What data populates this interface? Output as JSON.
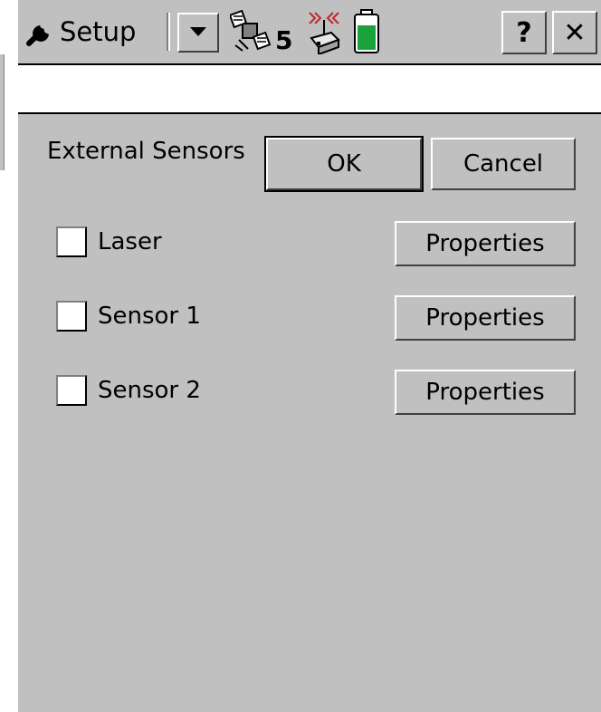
{
  "titlebar": {
    "app_name": "Setup",
    "satellite_count": "5",
    "help_label": "?",
    "close_label": "✕"
  },
  "input_bar": {
    "value": ""
  },
  "form": {
    "title": "External Sensors",
    "ok_label": "OK",
    "cancel_label": "Cancel",
    "sensors": [
      {
        "label": "Laser",
        "checked": false,
        "button_label": "Properties"
      },
      {
        "label": "Sensor 1",
        "checked": false,
        "button_label": "Properties"
      },
      {
        "label": "Sensor 2",
        "checked": false,
        "button_label": "Properties"
      }
    ]
  },
  "icons": {
    "app": "wrench-icon",
    "dropdown": "triangle-down-icon",
    "satellite": "satellite-icon",
    "radio": "radio-antenna-icon",
    "battery": "battery-icon"
  },
  "colors": {
    "background": "#c0c0c0",
    "battery_fill": "#1aa33a",
    "radio_signal": "#c0282a"
  }
}
